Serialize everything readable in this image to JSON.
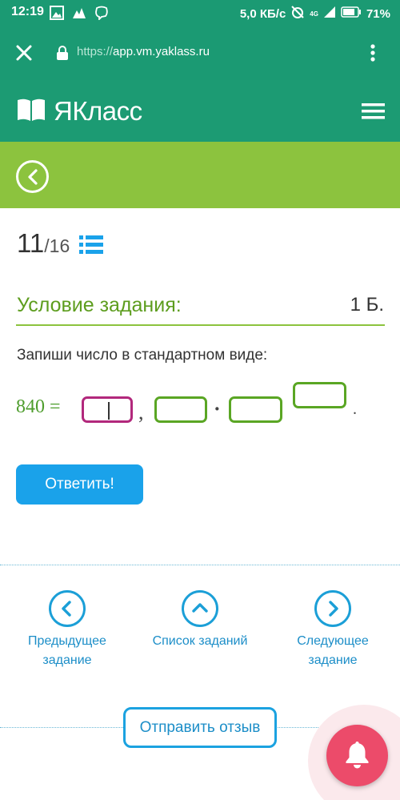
{
  "statusbar": {
    "time": "12:19",
    "net_speed": "5,0 КБ/с",
    "network_type": "4G",
    "battery": "71%",
    "icons": [
      "image-icon",
      "photo-icon",
      "viber-icon",
      "no-alarm-icon",
      "signal-icon",
      "battery-icon"
    ]
  },
  "browser": {
    "url_protocol": "https://",
    "url_host": "app.vm.yaklass.ru"
  },
  "site": {
    "logo_text": "ЯКласс"
  },
  "task": {
    "current": "11",
    "total": "/16",
    "condition_title": "Условие задания:",
    "points": "1 Б.",
    "question": "Запиши число в стандартном виде:",
    "equation_left": "840 =",
    "comma": ",",
    "dot": "·",
    "period": ".",
    "answer_button": "Ответить!"
  },
  "nav": {
    "prev_line1": "Предыдущее",
    "prev_line2": "задание",
    "list": "Список заданий",
    "next_line1": "Следующее",
    "next_line2": "задание"
  },
  "feedback_button": "Отправить отзыв",
  "colors": {
    "header_green": "#1c9b73",
    "lime": "#8cc33e",
    "blue": "#1aa2ea",
    "active_box": "#b2287c",
    "bell": "#ec4b6a"
  }
}
